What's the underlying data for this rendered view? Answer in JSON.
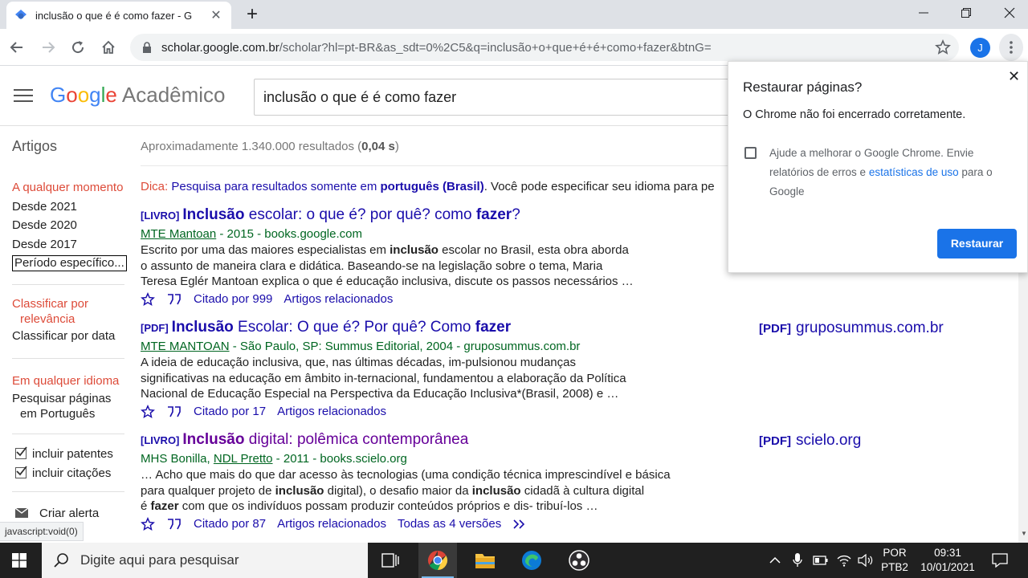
{
  "browser": {
    "tab_title": "inclusão o que é é como fazer - G",
    "url_host": "scholar.google.com.br",
    "url_rest": "/scholar?hl=pt-BR&as_sdt=0%2C5&q=inclusão+o+que+é+é+como+fazer&btnG=",
    "profile_initial": "J"
  },
  "scholar": {
    "logo": {
      "g1": "G",
      "g2": "o",
      "g3": "o",
      "g4": "g",
      "g5": "l",
      "g6": "e",
      "product": "Acadêmico"
    },
    "query": "inclusão o que é é como fazer",
    "section_label": "Artigos",
    "results_count_prefix": "Aproximadamente 1.340.000 resultados (",
    "results_time": "0,04 s",
    "results_count_suffix": ")",
    "sidebar": {
      "time_heading": "A qualquer momento",
      "time_items": [
        "Desde 2021",
        "Desde 2020",
        "Desde 2017"
      ],
      "period_specific": "Período específico...",
      "sort_heading_1": "Classificar por",
      "sort_heading_2": "relevância",
      "sort_by_date": "Classificar por data",
      "lang_heading": "Em qualquer idioma",
      "lang_item_1": "Pesquisar páginas",
      "lang_item_2": "em Português",
      "include_patents": "incluir patentes",
      "include_citations": "incluir citações",
      "create_alert": "Criar alerta"
    },
    "tip": {
      "label": "Dica:",
      "link_prefix": "Pesquisa para resultados somente em ",
      "link_bold": "português (Brasil)",
      "rest": ". Você pode especificar seu idioma para pe"
    },
    "results": [
      {
        "type": "[LIVRO]",
        "title_a": "Inclusão",
        "title_b": " escolar: o que é? por quê? como ",
        "title_c": "fazer",
        "title_d": "?",
        "author": "MTE Mantoan",
        "meta_rest": " - 2015 - books.google.com",
        "snippet_1a": "Escrito por uma das maiores especialistas em ",
        "snippet_1b": "inclusão",
        "snippet_1c": " escolar no Brasil, esta obra aborda",
        "snippet_2": "o assunto de maneira clara e didática. Baseando-se na legislação sobre o tema, Maria",
        "snippet_3": "Teresa Eglér Mantoan explica o que é educação inclusiva, discute os passos necessários …",
        "cited": "Citado por 999",
        "related": "Artigos relacionados"
      },
      {
        "type": "[PDF]",
        "title_a": "Inclusão",
        "title_b": " Escolar: O que é? Por quê? Como ",
        "title_c": "fazer",
        "title_d": "",
        "author": "MTE MANTOAN",
        "meta_rest": " - São Paulo, SP: Summus Editorial, 2004 - gruposummus.com.br",
        "snippet_1": "A ideia de educação inclusiva, que, nas últimas décadas, im-pulsionou mudanças",
        "snippet_2": "significativas na educação em âmbito in-ternacional, fundamentou a elaboração da Política",
        "snippet_3": "Nacional de Educação Especial na Perspectiva da Educação Inclusiva*(Brasil, 2008) e …",
        "cited": "Citado por 17",
        "related": "Artigos relacionados",
        "side_tag": "[PDF]",
        "side_host": "gruposummus.com.br"
      },
      {
        "type": "[LIVRO]",
        "title_a": "Inclusão",
        "title_b": " digital: polêmica contemporânea",
        "title_c": "",
        "title_d": "",
        "author_prefix": "MHS Bonilla, ",
        "author": "NDL Pretto",
        "meta_rest": " - 2011 - books.scielo.org",
        "snippet_1": "… Acho que mais do que dar acesso às tecnologias (uma condição técnica imprescindível e básica",
        "snippet_2a": "para qualquer projeto de ",
        "snippet_2b": "inclusão",
        "snippet_2c": " digital), o desafio maior da ",
        "snippet_2d": "inclusão",
        "snippet_2e": " cidadã à cultura digital",
        "snippet_3a": "é ",
        "snippet_3b": "fazer",
        "snippet_3c": " com que os indivíduos possam produzir conteúdos próprios e dis- tribuí-los …",
        "cited": "Citado por 87",
        "related": "Artigos relacionados",
        "versions": "Todas as 4 versões",
        "side_tag": "[PDF]",
        "side_host": "scielo.org"
      }
    ],
    "status_text": "javascript:void(0)"
  },
  "popup": {
    "title": "Restaurar páginas?",
    "message": "O Chrome não foi encerrado corretamente.",
    "help_prefix": "Ajude a melhorar o Google Chrome. Envie relatórios de erros e ",
    "help_link": "estatísticas de uso",
    "help_suffix": " para o Google",
    "button": "Restaurar"
  },
  "taskbar": {
    "search_placeholder": "Digite aqui para pesquisar",
    "lang_1": "POR",
    "lang_2": "PTB2",
    "time": "09:31",
    "date": "10/01/2021"
  },
  "colors": {
    "link": "#1a0dab",
    "visited": "#660099",
    "green_meta": "#006621",
    "scholar_red": "#dd4b39",
    "chrome_blue": "#1a73e8"
  }
}
